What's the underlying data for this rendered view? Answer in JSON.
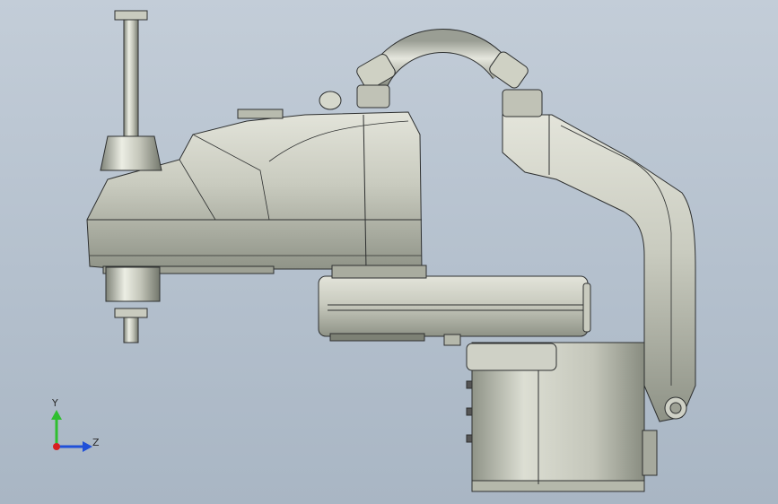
{
  "viewport": {
    "background_top": "#c3cdd8",
    "background_bottom": "#a9b6c4",
    "model": {
      "body_color": "#c9cbbf",
      "shade_color": "#9fa396",
      "edge_color": "#2e3030"
    }
  },
  "triad": {
    "y_label": "Y",
    "z_label": "Z",
    "y_color": "#2fbf2f",
    "z_color": "#2050d8",
    "x_color": "#d82020"
  }
}
